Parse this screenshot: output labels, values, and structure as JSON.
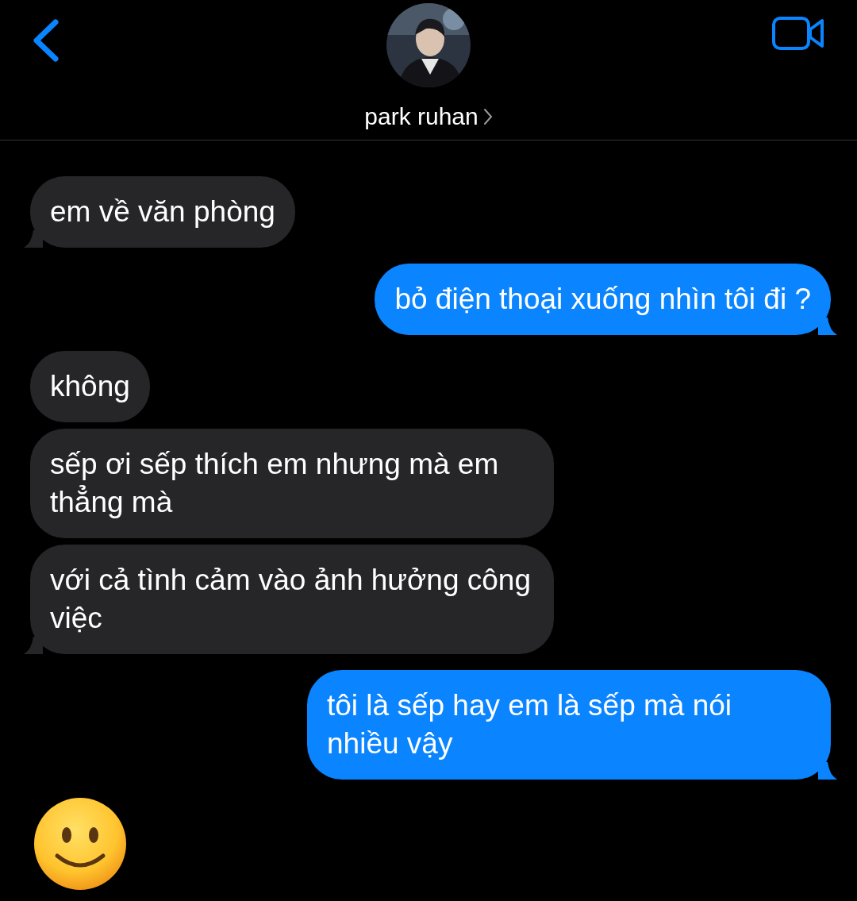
{
  "header": {
    "contact_name": "park ruhan"
  },
  "messages": [
    {
      "kind": "text",
      "outgoing": false,
      "text": "em về văn phòng",
      "tail": true
    },
    {
      "kind": "text",
      "outgoing": true,
      "text": "bỏ điện thoại xuống nhìn tôi đi ?",
      "tail": true
    },
    {
      "kind": "text",
      "outgoing": false,
      "text": "không",
      "tail": false
    },
    {
      "kind": "text",
      "outgoing": false,
      "text": "sếp ơi sếp thích em nhưng mà em thẳng mà",
      "tail": false
    },
    {
      "kind": "text",
      "outgoing": false,
      "text": "với cả tình cảm vào ảnh hưởng công việc",
      "tail": true
    },
    {
      "kind": "text",
      "outgoing": true,
      "text": "tôi là sếp hay em là sếp mà nói nhiều vậy",
      "tail": true
    },
    {
      "kind": "emoji",
      "outgoing": false
    }
  ]
}
